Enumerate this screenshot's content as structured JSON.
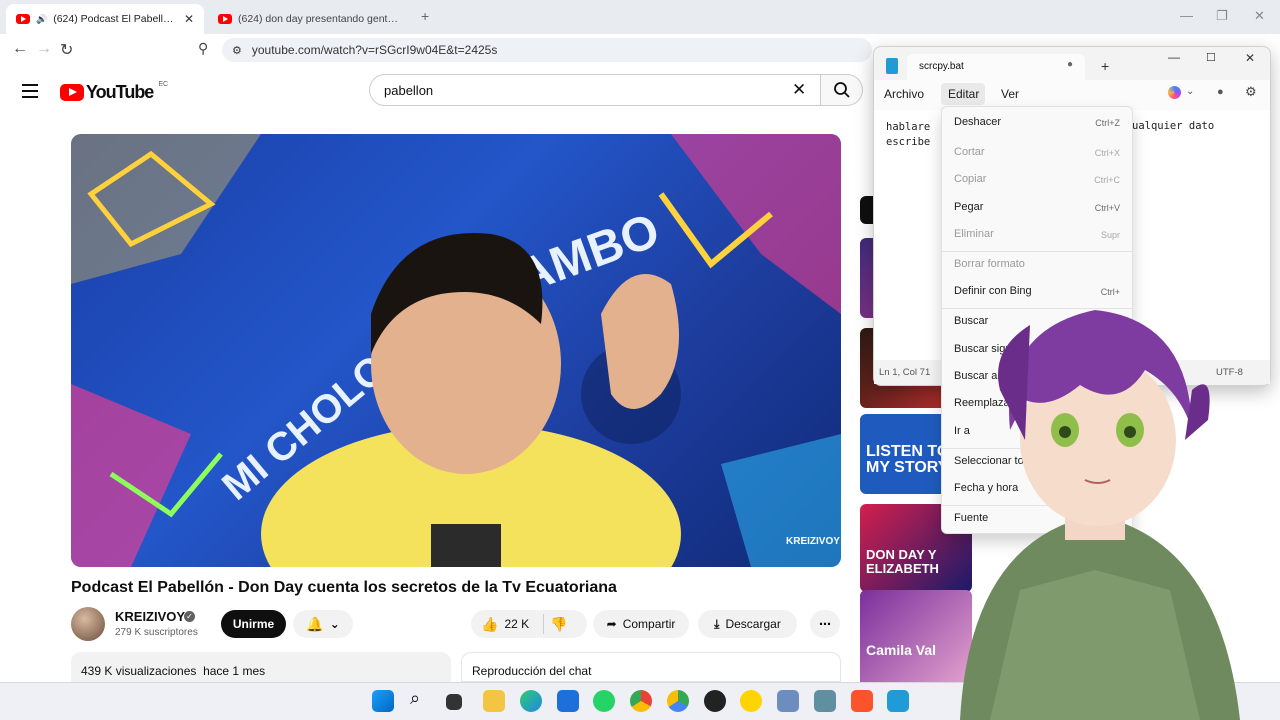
{
  "browser": {
    "tabs": [
      {
        "title": "(624) Podcast El Pabellón - Do",
        "active": true
      },
      {
        "title": "(624) don day presentando gente ec",
        "active": false
      }
    ],
    "new_tab": "+",
    "url": "youtube.com/watch?v=rSGcrI9w04E&t=2425s"
  },
  "youtube": {
    "logo_text": "YouTube",
    "country_code": "EC",
    "search_value": "pabellon",
    "video_title": "Podcast El Pabellón - Don Day cuenta los secretos de la Tv Ecuatoriana",
    "video_watermark": "KREIZIVOY",
    "channel": {
      "name": "KREIZIVOY",
      "subscribers": "279 K suscriptores",
      "join_label": "Unirme"
    },
    "likes": "22 K",
    "share_label": "Compartir",
    "download_label": "Descargar",
    "views": "439 K visualizaciones",
    "time_ago": "hace 1 mes",
    "chat_replay": "Reproducción del chat",
    "sidebar_thumbs": [
      {
        "text": "LISTEN TO MY STORY",
        "color": "#1f5bbf"
      },
      {
        "text": "DON DAY Y ELIZABETH",
        "color": "#d41f4d"
      },
      {
        "text": "Camila Val",
        "color": "#7a2f9c"
      }
    ]
  },
  "notepad": {
    "tab_title": "scrcpy.bat",
    "menus": [
      "Archivo",
      "Editar",
      "Ver"
    ],
    "text_line1": "hablare",
    "text_line1_right": "ualquier dato",
    "text_line2": "escribe",
    "status_left": "Ln 1, Col 71",
    "status_right": "UTF-8"
  },
  "edit_menu": [
    {
      "label": "Deshacer",
      "shortcut": "Ctrl+Z",
      "enabled": true
    },
    {
      "label": "Cortar",
      "shortcut": "Ctrl+X",
      "enabled": false
    },
    {
      "label": "Copiar",
      "shortcut": "Ctrl+C",
      "enabled": false
    },
    {
      "label": "Pegar",
      "shortcut": "Ctrl+V",
      "enabled": true
    },
    {
      "label": "Eliminar",
      "shortcut": "Supr",
      "enabled": false
    },
    {
      "label": "Borrar formato",
      "shortcut": "",
      "enabled": false
    },
    {
      "label": "Definir con Bing",
      "shortcut": "Ctrl+",
      "enabled": true
    },
    {
      "label": "Buscar",
      "shortcut": "",
      "enabled": true
    },
    {
      "label": "Buscar siguiente",
      "shortcut": "",
      "enabled": true
    },
    {
      "label": "Buscar anterior",
      "shortcut": "",
      "enabled": true
    },
    {
      "label": "Reemplazar",
      "shortcut": "",
      "enabled": true
    },
    {
      "label": "Ir a",
      "shortcut": "",
      "enabled": true
    },
    {
      "label": "Seleccionar todo",
      "shortcut": "",
      "enabled": true
    },
    {
      "label": "Fecha y hora",
      "shortcut": "",
      "enabled": true
    },
    {
      "label": "Fuente",
      "shortcut": "",
      "enabled": true
    }
  ],
  "taskbar_icons": [
    "windows-start",
    "search",
    "task-view",
    "file-explorer",
    "edge",
    "store",
    "whatsapp",
    "chrome",
    "chrome-alt",
    "obs",
    "norton",
    "vs",
    "settings",
    "brave",
    "notepad"
  ]
}
